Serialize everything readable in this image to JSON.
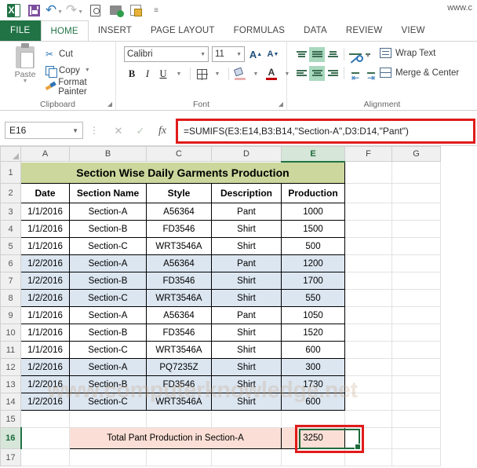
{
  "quick_access": {
    "url_text": "www.c",
    "items": [
      {
        "name": "excel-logo-icon",
        "label": "X"
      },
      {
        "name": "save-icon",
        "label": "Save"
      },
      {
        "name": "undo-icon",
        "label": "Undo"
      },
      {
        "name": "redo-icon",
        "label": "Redo"
      },
      {
        "name": "print-preview-icon",
        "label": "Print Preview and Print"
      },
      {
        "name": "email-icon",
        "label": "E-mail"
      },
      {
        "name": "protect-sheet-icon",
        "label": "Protect Sheet"
      },
      {
        "name": "customize-toolbar-icon",
        "label": "Customize Quick Access Toolbar"
      }
    ]
  },
  "ribbon": {
    "tabs": [
      {
        "label": "FILE",
        "active": false,
        "file": true
      },
      {
        "label": "HOME",
        "active": true
      },
      {
        "label": "INSERT",
        "active": false
      },
      {
        "label": "PAGE LAYOUT",
        "active": false
      },
      {
        "label": "FORMULAS",
        "active": false
      },
      {
        "label": "DATA",
        "active": false
      },
      {
        "label": "REVIEW",
        "active": false
      },
      {
        "label": "VIEW",
        "active": false
      }
    ],
    "clipboard": {
      "group_label": "Clipboard",
      "paste_label": "Paste",
      "cut_label": "Cut",
      "copy_label": "Copy",
      "format_painter_label": "Format Painter"
    },
    "font": {
      "group_label": "Font",
      "font_name": "Calibri",
      "font_size": "11",
      "bold_label": "B",
      "italic_label": "I",
      "underline_label": "U",
      "grow_label": "A",
      "shrink_label": "A"
    },
    "alignment": {
      "group_label": "Alignment",
      "wrap_text_label": "Wrap Text",
      "merge_center_label": "Merge & Center"
    }
  },
  "formula_bar": {
    "name_box": "E16",
    "formula": "=SUMIFS(E3:E14,B3:B14,\"Section-A\",D3:D14,\"Pant\")",
    "cancel_label": "✕",
    "enter_label": "✓",
    "fx_label": "fx"
  },
  "sheet": {
    "columns": [
      "A",
      "B",
      "C",
      "D",
      "E",
      "F",
      "G"
    ],
    "selected_column": "E",
    "selected_row": 16,
    "selected_cell": "E16",
    "title": "Section Wise Daily Garments Production",
    "headers": [
      "Date",
      "Section Name",
      "Style",
      "Description",
      "Production"
    ],
    "rows": [
      {
        "row": 3,
        "shaded": false,
        "cells": [
          "1/1/2016",
          "Section-A",
          "A56364",
          "Pant",
          "1000"
        ]
      },
      {
        "row": 4,
        "shaded": false,
        "cells": [
          "1/1/2016",
          "Section-B",
          "FD3546",
          "Shirt",
          "1500"
        ]
      },
      {
        "row": 5,
        "shaded": false,
        "cells": [
          "1/1/2016",
          "Section-C",
          "WRT3546A",
          "Shirt",
          "500"
        ]
      },
      {
        "row": 6,
        "shaded": true,
        "cells": [
          "1/2/2016",
          "Section-A",
          "A56364",
          "Pant",
          "1200"
        ]
      },
      {
        "row": 7,
        "shaded": true,
        "cells": [
          "1/2/2016",
          "Section-B",
          "FD3546",
          "Shirt",
          "1700"
        ]
      },
      {
        "row": 8,
        "shaded": true,
        "cells": [
          "1/2/2016",
          "Section-C",
          "WRT3546A",
          "Shirt",
          "550"
        ]
      },
      {
        "row": 9,
        "shaded": false,
        "cells": [
          "1/1/2016",
          "Section-A",
          "A56364",
          "Pant",
          "1050"
        ]
      },
      {
        "row": 10,
        "shaded": false,
        "cells": [
          "1/1/2016",
          "Section-B",
          "FD3546",
          "Shirt",
          "1520"
        ]
      },
      {
        "row": 11,
        "shaded": false,
        "cells": [
          "1/1/2016",
          "Section-C",
          "WRT3546A",
          "Shirt",
          "600"
        ]
      },
      {
        "row": 12,
        "shaded": true,
        "cells": [
          "1/2/2016",
          "Section-A",
          "PQ7235Z",
          "Shirt",
          "300"
        ]
      },
      {
        "row": 13,
        "shaded": true,
        "cells": [
          "1/2/2016",
          "Section-B",
          "FD3546",
          "Shirt",
          "1730"
        ]
      },
      {
        "row": 14,
        "shaded": true,
        "cells": [
          "1/2/2016",
          "Section-C",
          "WRT3546A",
          "Shirt",
          "600"
        ]
      }
    ],
    "total_row": {
      "row": 16,
      "label": "Total Pant Production in Section-A",
      "value": "3250"
    },
    "empty_row_numbers": [
      15,
      17
    ],
    "watermark": "www.computerknowledge.net"
  },
  "colors": {
    "excel_green": "#217346",
    "title_fill": "#cbd79c",
    "row_shade": "#dce6f1",
    "total_fill": "#fbdfd6",
    "highlight_red": "#e01b1b",
    "selection_green": "#1d6b3c"
  }
}
